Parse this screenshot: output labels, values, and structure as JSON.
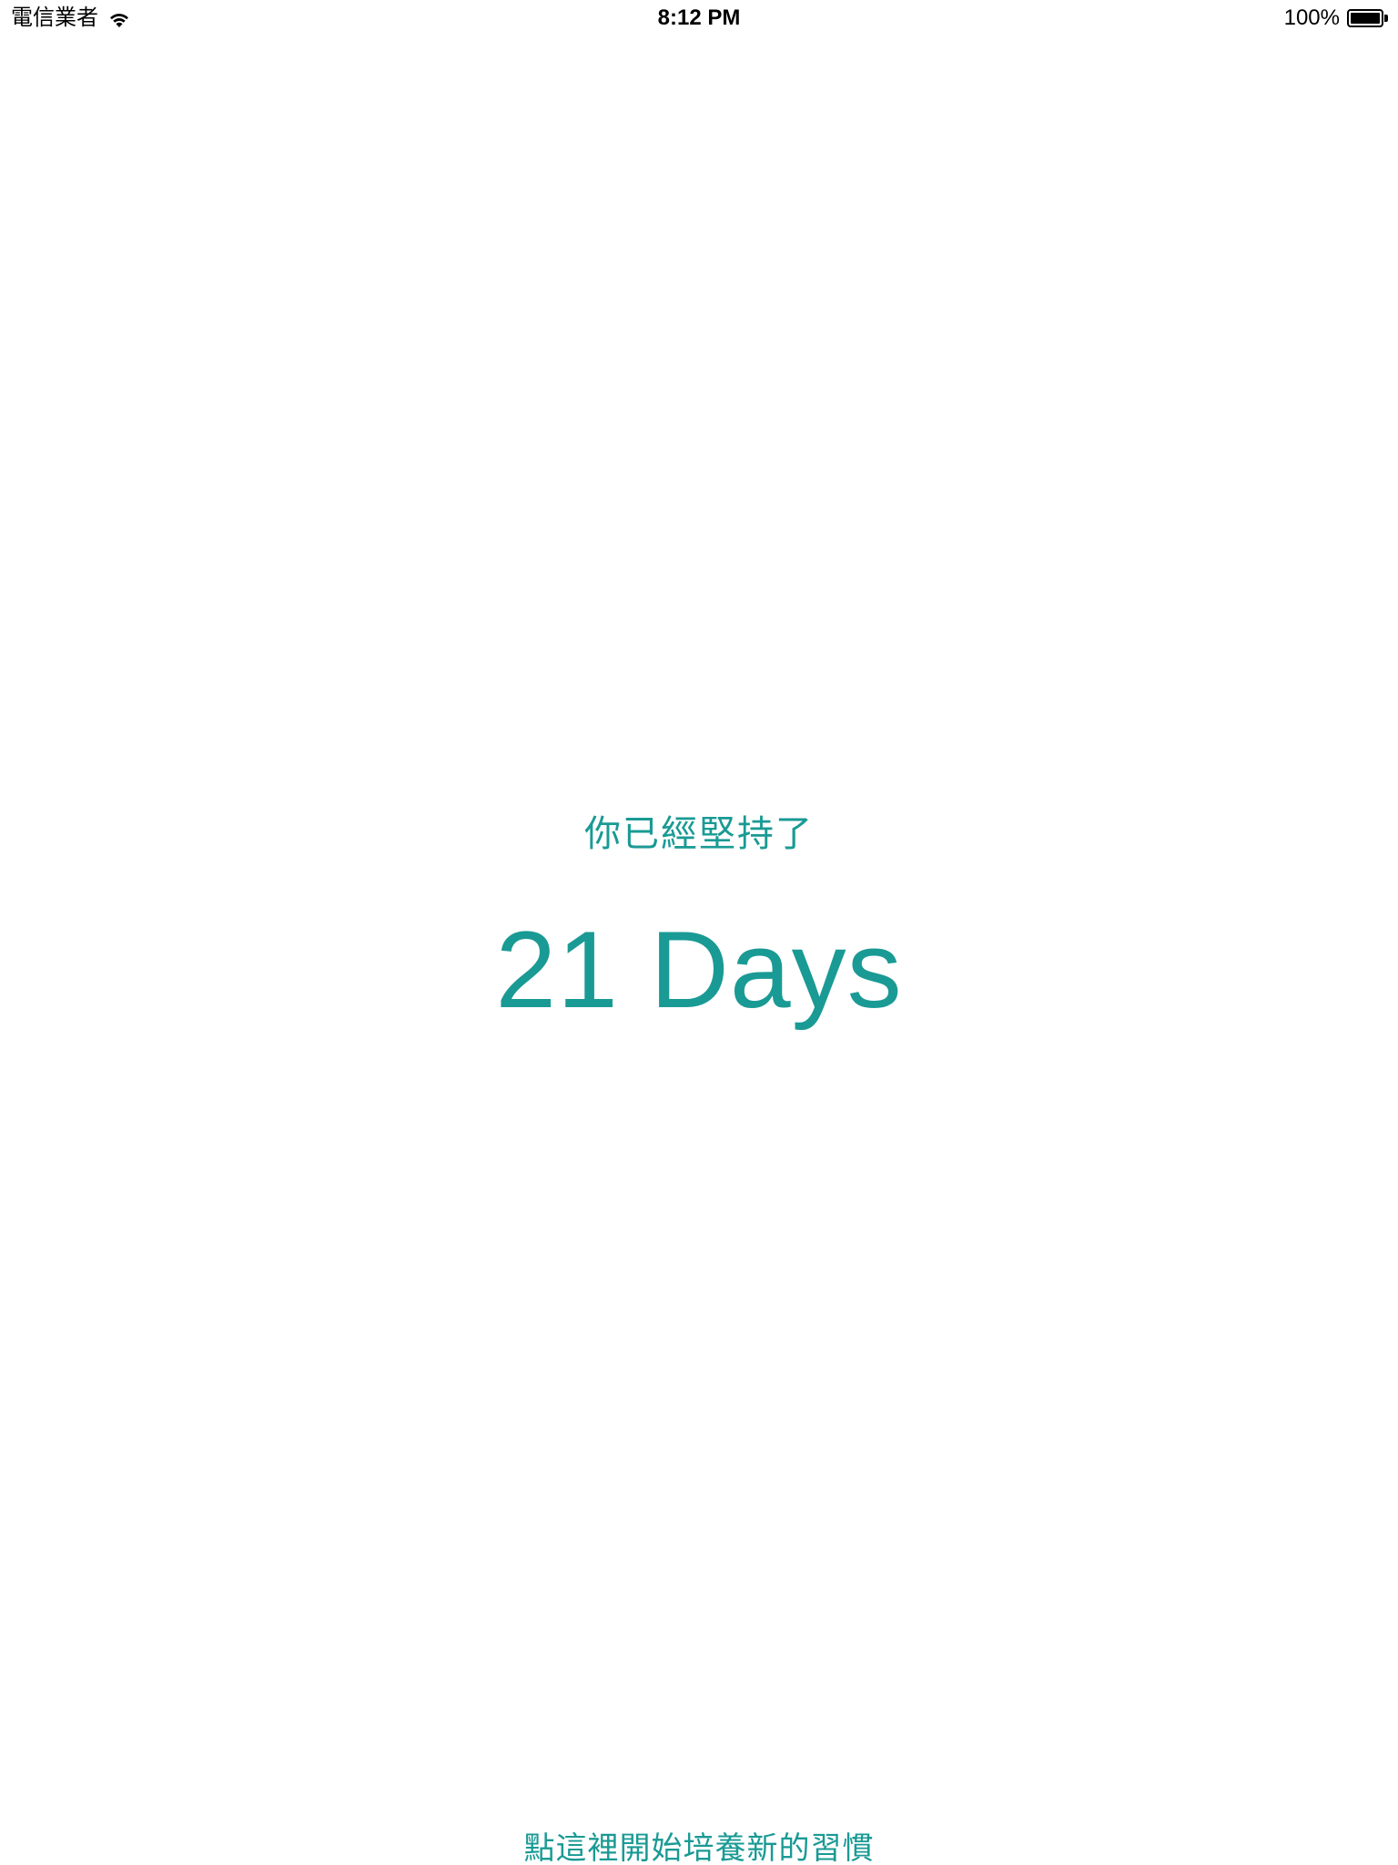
{
  "status_bar": {
    "carrier": "電信業者",
    "wifi_icon": "wifi-icon",
    "time": "8:12 PM",
    "battery_percent": "100%",
    "battery_level": 1.0,
    "battery_icon": "battery-icon"
  },
  "main": {
    "subtitle": "你已經堅持了",
    "days": "21 Days",
    "new_habit_link": "點這裡開始培養新的習慣"
  },
  "colors": {
    "accent": "#1a9a94",
    "background": "#ffffff",
    "status_text": "#000000"
  }
}
